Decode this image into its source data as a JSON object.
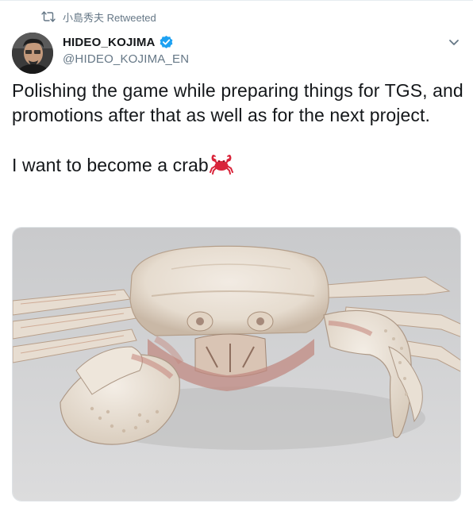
{
  "retweet": {
    "icon": "retweet-icon",
    "text": "小島秀夫 Retweeted"
  },
  "author": {
    "display_name": "HIDEO_KOJIMA",
    "handle": "@HIDEO_KOJIMA_EN",
    "verified": true,
    "avatar": "avatar-photo"
  },
  "menu": {
    "icon": "chevron-down-icon"
  },
  "tweet": {
    "line1": "Polishing the game while preparing things for TGS, and promotions after that as well as for the next project.",
    "line2": "I want to become a crab",
    "emoji": "crab-emoji"
  },
  "media": {
    "type": "photo",
    "subject": "crab-photo"
  },
  "colors": {
    "text": "#14171a",
    "secondary": "#657786",
    "verified_blue": "#1da1f2",
    "crab_red": "#d9243a"
  }
}
